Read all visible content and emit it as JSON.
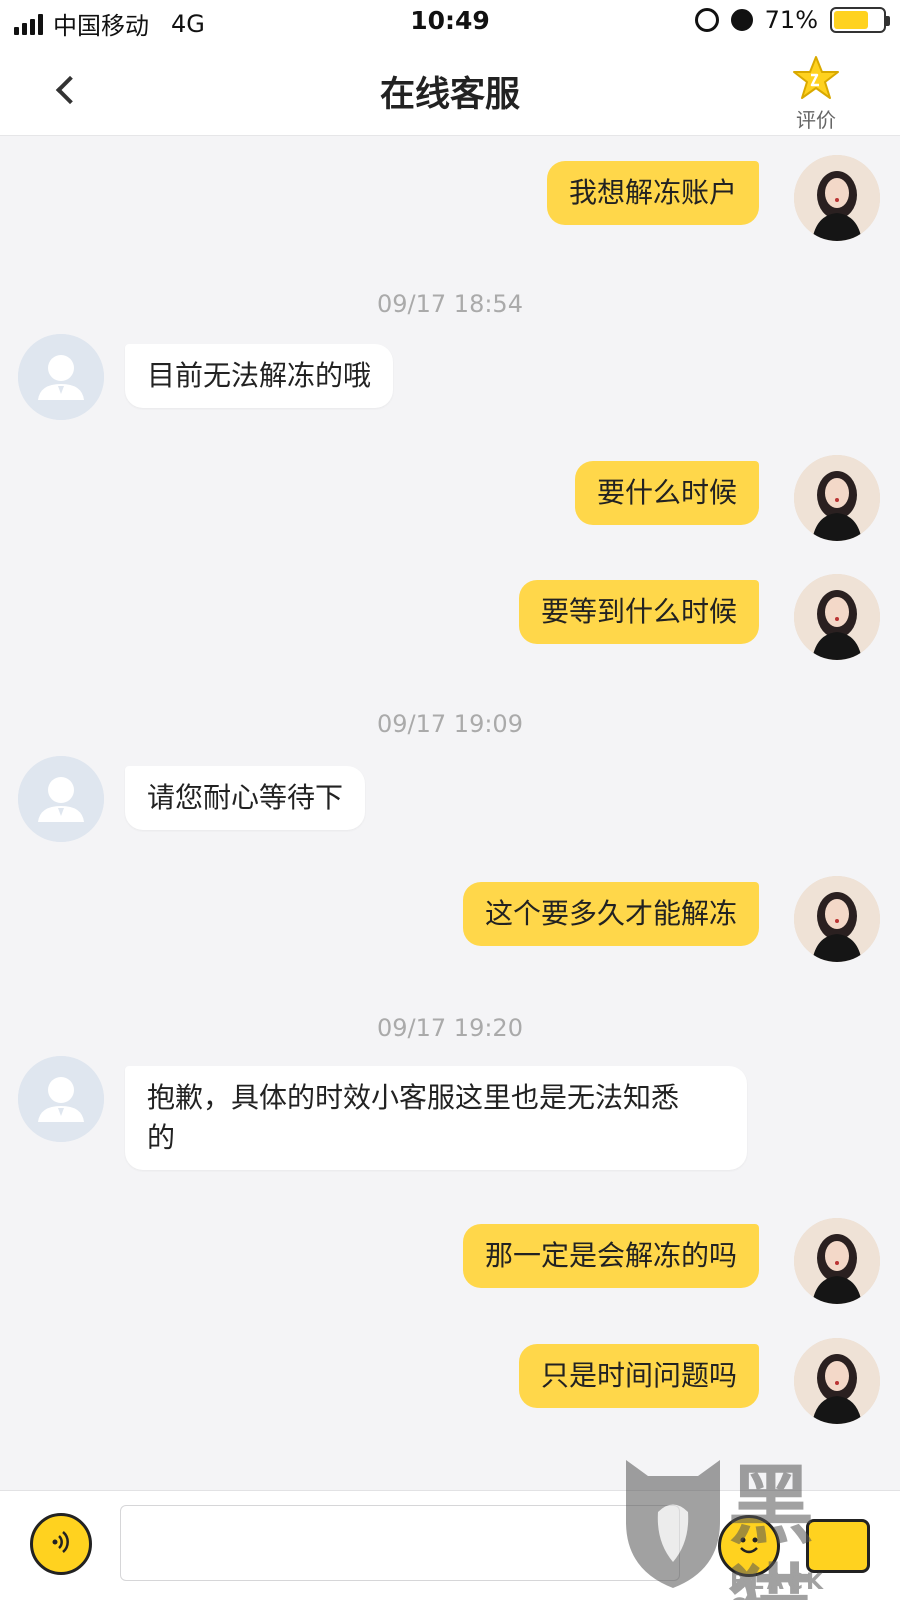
{
  "status_bar": {
    "carrier": "中国移动",
    "network": "4G",
    "time": "10:49",
    "battery_percent": "71%",
    "battery_level": 0.71
  },
  "nav": {
    "title": "在线客服",
    "rate_label": "评价",
    "icons": {
      "back": "chevron-left-icon",
      "rate": "star-icon"
    }
  },
  "messages": [
    {
      "side": "user",
      "text": "我想解冻账户"
    },
    {
      "side": "time",
      "text": "09/17 18:54"
    },
    {
      "side": "agent",
      "text": "目前无法解冻的哦"
    },
    {
      "side": "user",
      "text": "要什么时候"
    },
    {
      "side": "user",
      "text": "要等到什么时候"
    },
    {
      "side": "time",
      "text": "09/17 19:09"
    },
    {
      "side": "agent",
      "text": "请您耐心等待下"
    },
    {
      "side": "user",
      "text": "这个要多久才能解冻"
    },
    {
      "side": "time",
      "text": "09/17 19:20"
    },
    {
      "side": "agent",
      "text": "抱歉，具体的时效小客服这里也是无法知悉\n的"
    },
    {
      "side": "user",
      "text": "那一定是会解冻的吗"
    },
    {
      "side": "user",
      "text": "只是时间问题吗"
    }
  ],
  "input_bar": {
    "placeholder": "",
    "icons": {
      "voice": "voice-icon",
      "emoji": "emoji-icon",
      "more": "more-icon"
    }
  },
  "watermark": {
    "cn": "黑猫",
    "en": "BLACK CAT"
  },
  "colors": {
    "accent": "#ffd74a",
    "background": "#f4f4f6",
    "agent_bubble": "#ffffff",
    "time_label": "#aaaaaa"
  }
}
